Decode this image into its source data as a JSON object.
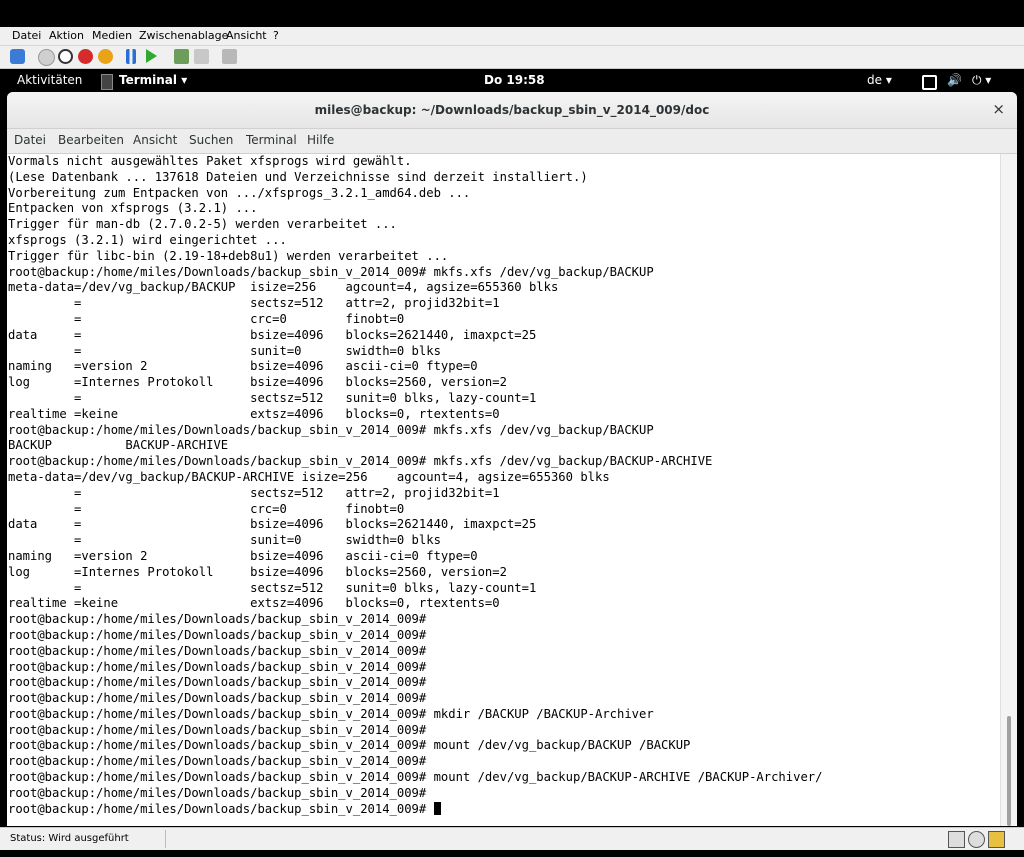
{
  "host_menu": [
    "Datei",
    "Aktion",
    "Medien",
    "Zwischenablage",
    "Ansicht",
    "?"
  ],
  "toolbar": {
    "icons": [
      "settings-icon",
      "power-icon",
      "stop-icon",
      "reset-icon",
      "shutdown-icon",
      "pause-icon",
      "play-icon",
      "snapshot-icon",
      "revert-icon",
      "ctrl-alt-del-icon"
    ]
  },
  "gnome": {
    "activities": "Aktivitäten",
    "app_menu": "Terminal ▾",
    "clock": "Do 19:58",
    "keyboard": "de ▾",
    "system_menu": "⏻ ▾"
  },
  "window": {
    "title": "miles@backup: ~/Downloads/backup_sbin_v_2014_009/doc",
    "close": "×"
  },
  "terminal_menu": [
    "Datei",
    "Bearbeiten",
    "Ansicht",
    "Suchen",
    "Terminal",
    "Hilfe"
  ],
  "terminal": {
    "lines": [
      "Vormals nicht ausgewähltes Paket xfsprogs wird gewählt.",
      "(Lese Datenbank ... 137618 Dateien und Verzeichnisse sind derzeit installiert.)",
      "Vorbereitung zum Entpacken von .../xfsprogs_3.2.1_amd64.deb ...",
      "Entpacken von xfsprogs (3.2.1) ...",
      "Trigger für man-db (2.7.0.2-5) werden verarbeitet ...",
      "xfsprogs (3.2.1) wird eingerichtet ...",
      "Trigger für libc-bin (2.19-18+deb8u1) werden verarbeitet ...",
      "root@backup:/home/miles/Downloads/backup_sbin_v_2014_009# mkfs.xfs /dev/vg_backup/BACKUP",
      "meta-data=/dev/vg_backup/BACKUP  isize=256    agcount=4, agsize=655360 blks",
      "         =                       sectsz=512   attr=2, projid32bit=1",
      "         =                       crc=0        finobt=0",
      "data     =                       bsize=4096   blocks=2621440, imaxpct=25",
      "         =                       sunit=0      swidth=0 blks",
      "naming   =version 2              bsize=4096   ascii-ci=0 ftype=0",
      "log      =Internes Protokoll     bsize=4096   blocks=2560, version=2",
      "         =                       sectsz=512   sunit=0 blks, lazy-count=1",
      "realtime =keine                  extsz=4096   blocks=0, rtextents=0",
      "root@backup:/home/miles/Downloads/backup_sbin_v_2014_009# mkfs.xfs /dev/vg_backup/BACKUP",
      "BACKUP          BACKUP-ARCHIVE",
      "root@backup:/home/miles/Downloads/backup_sbin_v_2014_009# mkfs.xfs /dev/vg_backup/BACKUP-ARCHIVE",
      "meta-data=/dev/vg_backup/BACKUP-ARCHIVE isize=256    agcount=4, agsize=655360 blks",
      "         =                       sectsz=512   attr=2, projid32bit=1",
      "         =                       crc=0        finobt=0",
      "data     =                       bsize=4096   blocks=2621440, imaxpct=25",
      "         =                       sunit=0      swidth=0 blks",
      "naming   =version 2              bsize=4096   ascii-ci=0 ftype=0",
      "log      =Internes Protokoll     bsize=4096   blocks=2560, version=2",
      "         =                       sectsz=512   sunit=0 blks, lazy-count=1",
      "realtime =keine                  extsz=4096   blocks=0, rtextents=0",
      "root@backup:/home/miles/Downloads/backup_sbin_v_2014_009#",
      "root@backup:/home/miles/Downloads/backup_sbin_v_2014_009#",
      "root@backup:/home/miles/Downloads/backup_sbin_v_2014_009#",
      "root@backup:/home/miles/Downloads/backup_sbin_v_2014_009#",
      "root@backup:/home/miles/Downloads/backup_sbin_v_2014_009#",
      "root@backup:/home/miles/Downloads/backup_sbin_v_2014_009#",
      "root@backup:/home/miles/Downloads/backup_sbin_v_2014_009# mkdir /BACKUP /BACKUP-Archiver",
      "root@backup:/home/miles/Downloads/backup_sbin_v_2014_009#",
      "root@backup:/home/miles/Downloads/backup_sbin_v_2014_009# mount /dev/vg_backup/BACKUP /BACKUP",
      "root@backup:/home/miles/Downloads/backup_sbin_v_2014_009#",
      "root@backup:/home/miles/Downloads/backup_sbin_v_2014_009# mount /dev/vg_backup/BACKUP-ARCHIVE /BACKUP-Archiver/",
      "root@backup:/home/miles/Downloads/backup_sbin_v_2014_009#",
      "root@backup:/home/miles/Downloads/backup_sbin_v_2014_009# "
    ]
  },
  "status_bar": {
    "text": "Status: Wird ausgeführt"
  }
}
